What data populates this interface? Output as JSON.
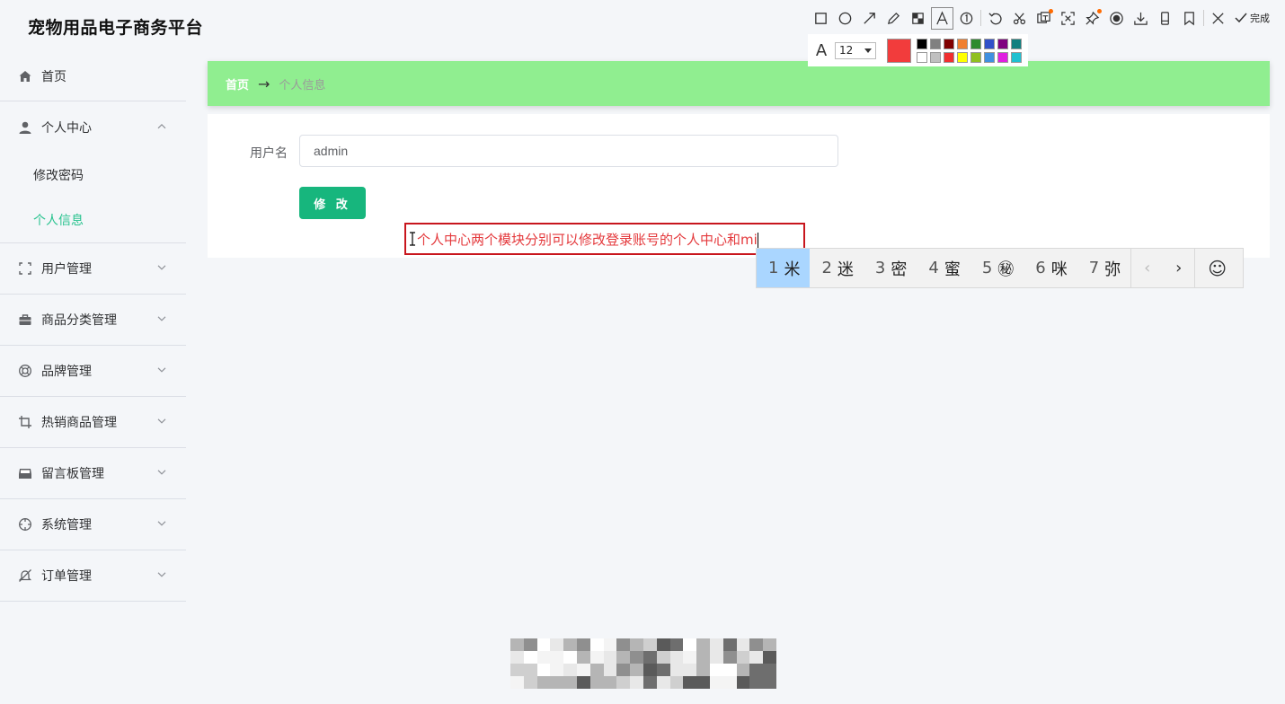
{
  "app": {
    "title": "宠物用品电子商务平台"
  },
  "sidebar": {
    "home": {
      "label": "首页",
      "icon": "home-icon"
    },
    "personal_center": {
      "label": "个人中心",
      "icon": "user-icon",
      "children": [
        {
          "label": "修改密码",
          "active": false
        },
        {
          "label": "个人信息",
          "active": true
        }
      ]
    },
    "items": [
      {
        "label": "用户管理",
        "icon": "frame-icon"
      },
      {
        "label": "商品分类管理",
        "icon": "briefcase-icon"
      },
      {
        "label": "品牌管理",
        "icon": "lifebuoy-icon"
      },
      {
        "label": "热销商品管理",
        "icon": "crop-icon"
      },
      {
        "label": "留言板管理",
        "icon": "inbox-icon"
      },
      {
        "label": "系统管理",
        "icon": "crosshair-icon"
      },
      {
        "label": "订单管理",
        "icon": "bell-off-icon"
      }
    ]
  },
  "breadcrumb": {
    "home": "首页",
    "separator": "→",
    "current": "个人信息"
  },
  "form": {
    "username_label": "用户名",
    "username_value": "admin",
    "submit_label": "修 改"
  },
  "annotation": {
    "text": "个人中心两个模块分别可以修改登录账号的个人中心和mi"
  },
  "ime": {
    "candidates": [
      {
        "num": "1",
        "text": "米"
      },
      {
        "num": "2",
        "text": "迷"
      },
      {
        "num": "3",
        "text": "密"
      },
      {
        "num": "4",
        "text": "蜜"
      },
      {
        "num": "5",
        "text": "㊙"
      },
      {
        "num": "6",
        "text": "咪"
      },
      {
        "num": "7",
        "text": "弥"
      }
    ],
    "prev": "‹",
    "next": "›",
    "emoji": "☺"
  },
  "screenshot_tool": {
    "font_icon": "A",
    "font_size": "12",
    "done_label": "完成",
    "current_color": "#f23c3c",
    "palette": [
      "#000000",
      "#808080",
      "#800000",
      "#f08030",
      "#2e8b2e",
      "#3050c8",
      "#800080",
      "#108080",
      "#ffffff",
      "#c0c0c0",
      "#f03030",
      "#ffff00",
      "#90c020",
      "#4090e0",
      "#e020e0",
      "#20c0d0"
    ]
  },
  "theme": {
    "accent": "#17b67d",
    "active_nav": "#27c28e",
    "breadcrumb_bg": "#90ee90"
  }
}
